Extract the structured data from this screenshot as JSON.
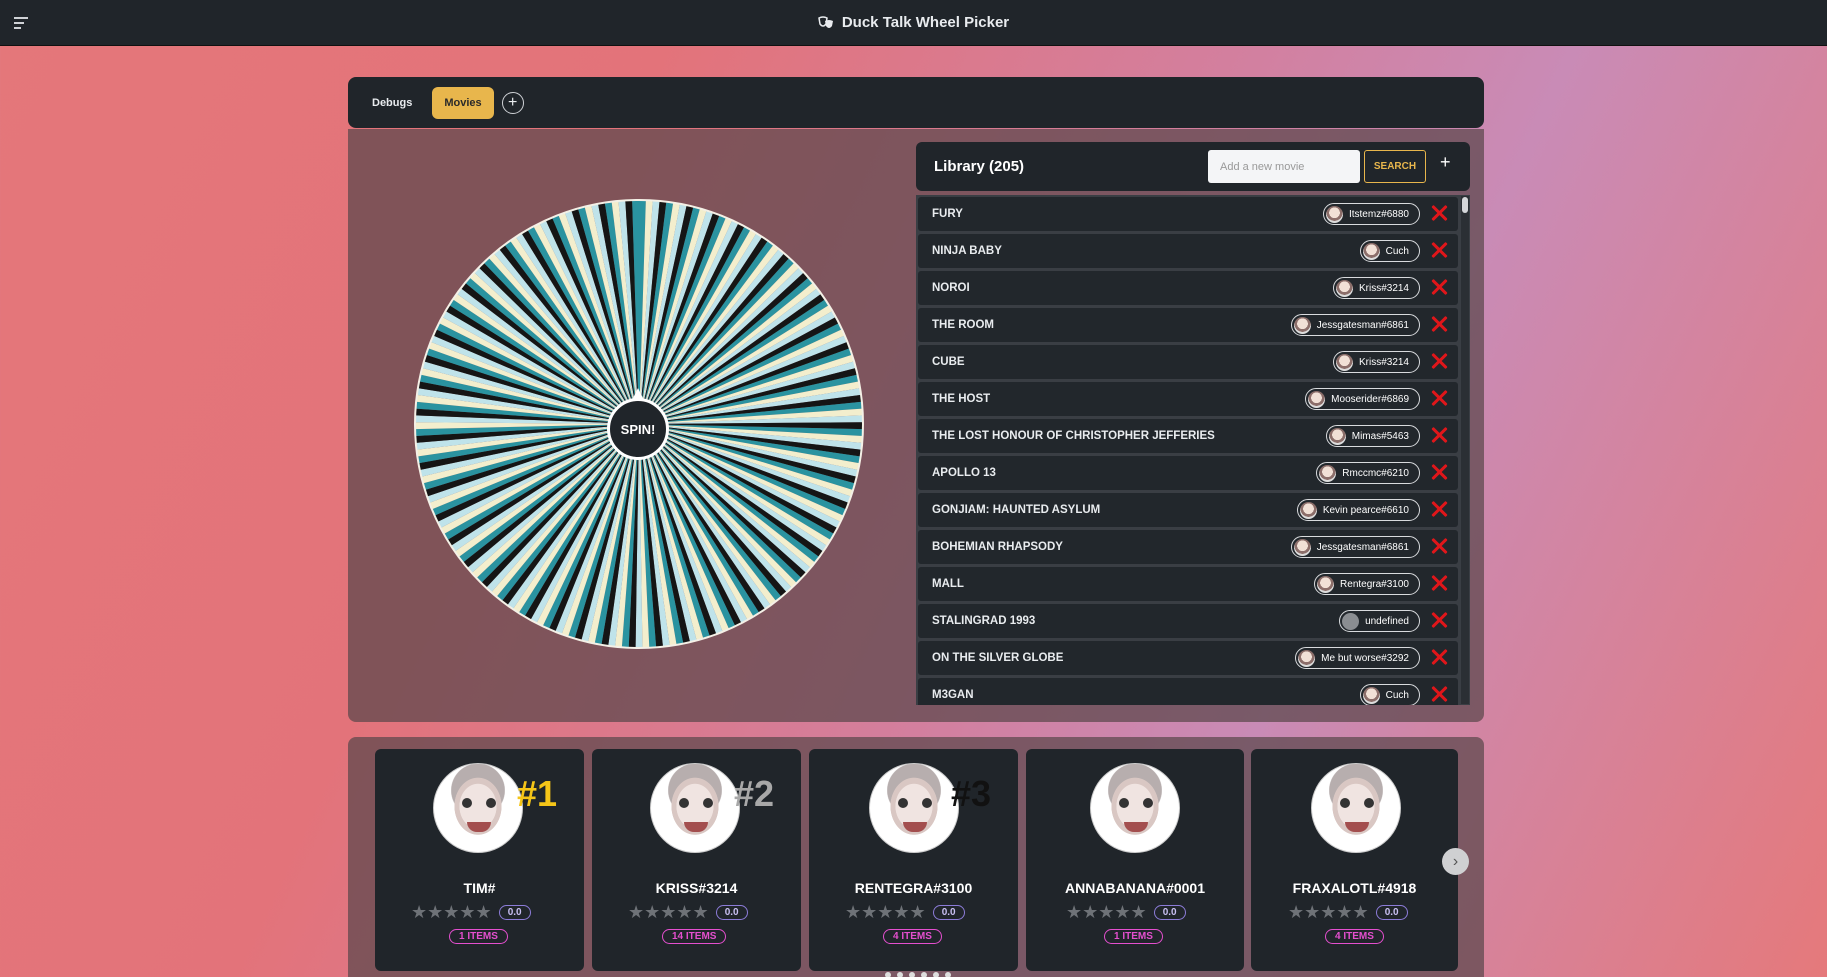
{
  "app": {
    "title": "Duck Talk Wheel Picker"
  },
  "tabs": [
    {
      "label": "Debugs",
      "active": false
    },
    {
      "label": "Movies",
      "active": true
    }
  ],
  "wheel": {
    "spin_label": "SPIN!",
    "colors": [
      "#2a93a0",
      "#f3eecd",
      "#bfe3ea",
      "#151515"
    ]
  },
  "library": {
    "title": "Library (205)",
    "input_placeholder": "Add a new movie",
    "search_label": "SEARCH",
    "add_label": "+",
    "movies": [
      {
        "title": "FURY",
        "user": "Itstemz#6880"
      },
      {
        "title": "NINJA BABY",
        "user": "Cuch"
      },
      {
        "title": "NOROI",
        "user": "Kriss#3214"
      },
      {
        "title": "THE ROOM",
        "user": "Jessgatesman#6861"
      },
      {
        "title": "CUBE",
        "user": "Kriss#3214"
      },
      {
        "title": "THE HOST",
        "user": "Mooserider#6869"
      },
      {
        "title": "THE LOST HONOUR OF CHRISTOPHER JEFFERIES",
        "user": "Mimas#5463"
      },
      {
        "title": "APOLLO 13",
        "user": "Rmccmc#6210"
      },
      {
        "title": "GONJIAM: HAUNTED ASYLUM",
        "user": "Kevin pearce#6610"
      },
      {
        "title": "BOHEMIAN RHAPSODY",
        "user": "Jessgatesman#6861"
      },
      {
        "title": "MALL",
        "user": "Rentegra#3100"
      },
      {
        "title": "STALINGRAD 1993",
        "user": "undefined"
      },
      {
        "title": "ON THE SILVER GLOBE",
        "user": "Me but worse#3292"
      },
      {
        "title": "M3GAN",
        "user": "Cuch"
      }
    ]
  },
  "users": [
    {
      "rank": "#1",
      "rank_color": "#f5c518",
      "name": "TIM#",
      "rating": "0.0",
      "items": "1 ITEMS"
    },
    {
      "rank": "#2",
      "rank_color": "#a8a8a8",
      "name": "KRISS#3214",
      "rating": "0.0",
      "items": "14 ITEMS"
    },
    {
      "rank": "#3",
      "rank_color": "#111111",
      "name": "RENTEGRA#3100",
      "rating": "0.0",
      "items": "4 ITEMS"
    },
    {
      "rank": "",
      "rank_color": "",
      "name": "ANNABANANA#0001",
      "rating": "0.0",
      "items": "1 ITEMS"
    },
    {
      "rank": "",
      "rank_color": "",
      "name": "FRAXALOTL#4918",
      "rating": "0.0",
      "items": "4 ITEMS"
    }
  ]
}
